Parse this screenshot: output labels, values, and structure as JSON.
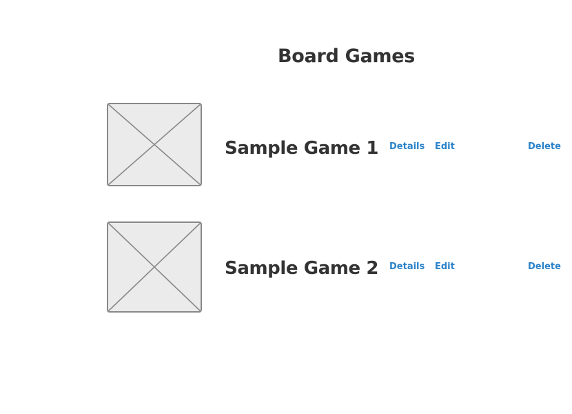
{
  "page": {
    "title": "Board Games"
  },
  "games": [
    {
      "title": "Sample Game 1",
      "thumbnail_icon": "image-placeholder-icon",
      "actions": {
        "details": "Details",
        "edit": "Edit",
        "delete": "Delete"
      }
    },
    {
      "title": "Sample Game 2",
      "thumbnail_icon": "image-placeholder-icon",
      "actions": {
        "details": "Details",
        "edit": "Edit",
        "delete": "Delete"
      }
    }
  ],
  "colors": {
    "text": "#333333",
    "link": "#2b82c9",
    "placeholder_fill": "#ebebeb",
    "placeholder_stroke": "#888888"
  }
}
